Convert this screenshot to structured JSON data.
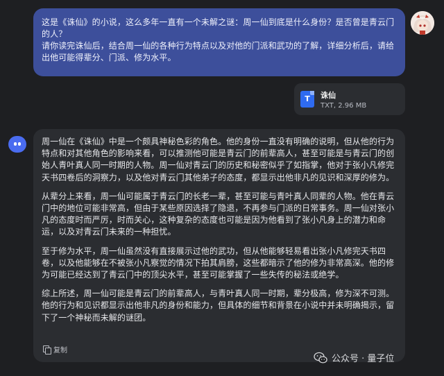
{
  "conversation": {
    "user_message": {
      "line1": "这是《诛仙》的小说，这么多年一直有一个未解之谜：周一仙到底是什么身份？是否曾是青云门的人？",
      "line2": "请你读完诛仙后，结合周一仙的各种行为特点以及对他的门派和武功的了解，详细分析后，请给出他可能得辈分、门派、修为水平。"
    },
    "attachment": {
      "icon_letter": "T",
      "file_name": "诛仙",
      "file_meta": "TXT, 2.96 MB"
    },
    "assistant_reply": {
      "paragraphs": [
        "周一仙在《诛仙》中是一个颇具神秘色彩的角色。他的身份一直没有明确的说明，但从他的行为特点和对其他角色的影响来看，可以推测他可能是青云门的前辈高人，甚至可能是与青云门的创始人青叶真人同一时期的人物。周一仙对青云门的历史和秘密似乎了如指掌，他对于张小凡修完天书四卷后的洞察力，以及他对青云门其他弟子的态度，都显示出他非凡的见识和深厚的修为。",
        "从辈分上来看，周一仙可能属于青云门的长老一辈，甚至可能与青叶真人同辈的人物。他在青云门中的地位可能非常高，但由于某些原因选择了隐退，不再参与门派的日常事务。周一仙对张小凡的态度时而严厉，时而关心，这种复杂的态度也可能是因为他看到了张小凡身上的潜力和命运，以及对青云门未来的一种担忧。",
        "至于修为水平，周一仙虽然没有直接展示过他的武功，但从他能够轻易看出张小凡修完天书四卷，以及他能够在不被张小凡察觉的情况下拍其肩膀，这些都暗示了他的修为非常高深。他的修为可能已经达到了青云门中的顶尖水平，甚至可能掌握了一些失传的秘法或绝学。",
        "综上所述，周一仙可能是青云门的前辈高人，与青叶真人同一时期，辈分极高，修为深不可测。他的行为和见识都显示出他非凡的身份和能力，但具体的细节和背景在小说中并未明确揭示，留下了一个神秘而未解的谜团。"
      ],
      "copy_label": "复制"
    }
  },
  "watermark": {
    "text": "公众号 · 量子位",
    "icon": "wechat-icon"
  },
  "colors": {
    "background": "#1e1f22",
    "user_bubble": "#3d4f9b",
    "reply_bubble": "#2b2d31",
    "bot_accent": "#4a6cf0",
    "file_icon": "#2f6bf0"
  }
}
